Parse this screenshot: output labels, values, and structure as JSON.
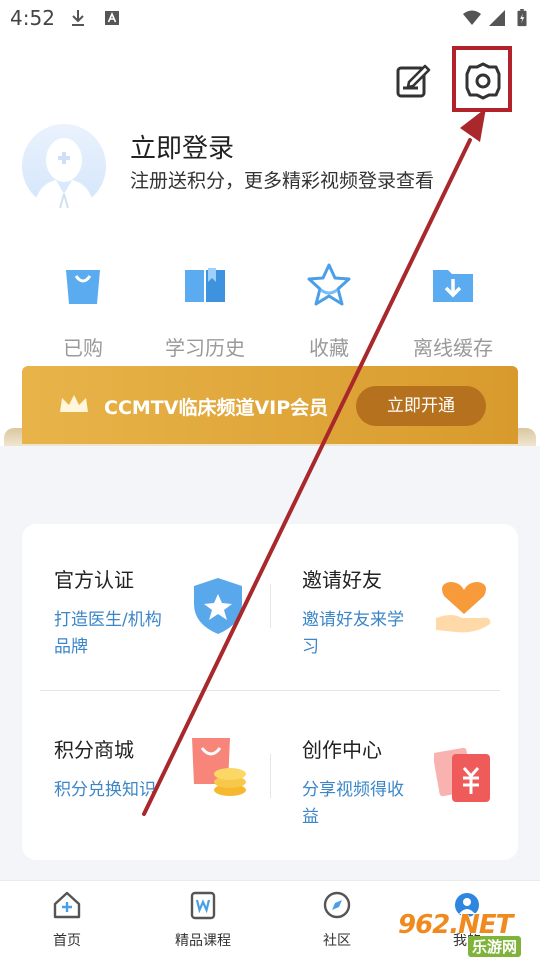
{
  "status_bar": {
    "time": "4:52",
    "icons": [
      "download-icon",
      "a-badge-icon",
      "wifi-icon",
      "signal-icon",
      "battery-icon"
    ]
  },
  "header": {
    "icons": [
      "edit-icon",
      "settings-icon"
    ]
  },
  "profile": {
    "title": "立即登录",
    "subtitle": "注册送积分，更多精彩视频登录查看"
  },
  "quick_actions": [
    {
      "label": "已购",
      "icon": "shopping-bag-icon"
    },
    {
      "label": "学习历史",
      "icon": "book-icon"
    },
    {
      "label": "收藏",
      "icon": "star-icon"
    },
    {
      "label": "离线缓存",
      "icon": "download-folder-icon"
    }
  ],
  "vip": {
    "text": "CCMTV临床频道VIP会员",
    "button": "立即开通"
  },
  "features": [
    {
      "title": "官方认证",
      "desc": "打造医生/机构品牌",
      "desc_lines": [
        "打造医生/机构",
        "品牌"
      ],
      "icon": "shield-star-icon"
    },
    {
      "title": "邀请好友",
      "desc": "邀请好友来学习",
      "desc_lines": [
        "邀请好友来学",
        "习"
      ],
      "icon": "heart-hand-icon"
    },
    {
      "title": "积分商城",
      "desc": "积分兑换知识",
      "desc_lines": [
        "积分兑换知识"
      ],
      "icon": "shopping-coins-icon"
    },
    {
      "title": "创作中心",
      "desc": "分享视频得收益",
      "desc_lines": [
        "分享视频得收",
        "益"
      ],
      "icon": "red-envelope-icon"
    }
  ],
  "bottom_nav": [
    {
      "label": "首页",
      "icon": "home-icon"
    },
    {
      "label": "精品课程",
      "icon": "course-icon"
    },
    {
      "label": "社区",
      "icon": "compass-icon"
    },
    {
      "label": "我的",
      "icon": "profile-icon"
    }
  ],
  "watermark": {
    "text": "962.NET",
    "subtext": "乐游网"
  },
  "colors": {
    "accent_blue": "#3b86c9",
    "vip_gold": "#e0a53a",
    "vip_button": "#b5711e",
    "annotation_red": "#b3212a",
    "icon_blue": "#4a9fe8"
  }
}
